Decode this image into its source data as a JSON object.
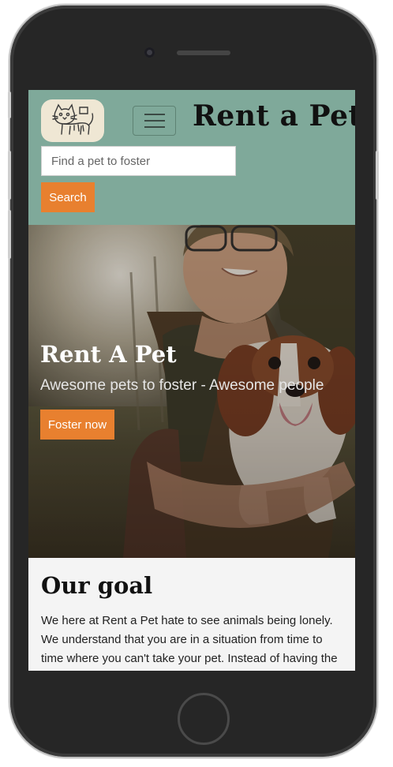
{
  "header": {
    "brand": "Rent a Pet",
    "logo_icon": "cat-drawing-icon",
    "menu_icon": "hamburger-menu-icon",
    "search_placeholder": "Find a pet to foster",
    "search_button": "Search"
  },
  "hero": {
    "title": "Rent A Pet",
    "subtitle": "Awesome pets to foster - Awesome people",
    "cta": "Foster now"
  },
  "goal": {
    "title": "Our goal",
    "text": "We here at Rent a Pet hate to see animals being lonely. We understand that you are in a situation from time to time where you can't take your pet. Instead of having the high costs of a"
  },
  "colors": {
    "header_bg": "#7fa99a",
    "accent": "#e8802f",
    "phone_frame": "#262626"
  }
}
